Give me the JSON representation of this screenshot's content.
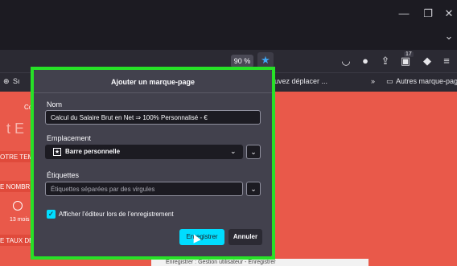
{
  "toolbar": {
    "zoom": "90 %",
    "bookmark_star_icon": "star-icon",
    "badge_count": "17"
  },
  "bookmarks_bar": {
    "left_fragment": "Sı",
    "move_hint": "uvez déplacer ...",
    "other_bookmarks": "Autres marque-pages"
  },
  "page_behind": {
    "frag_co": "Co",
    "frag_te": "t E",
    "frag_votre": "OTRE TEM",
    "frag_nombre": "E NOMBRE",
    "frag_mois": "13 mois",
    "frag_taux": "E TAUX DE"
  },
  "dialog": {
    "title": "Ajouter un marque-page",
    "name_label": "Nom",
    "name_value": "Calcul du Salaire Brut en Net ⇒ 100% Personnalisé - €",
    "location_label": "Emplacement",
    "location_value": "Barre personnelle",
    "tags_label": "Étiquettes",
    "tags_placeholder": "Étiquettes séparées par des virgules",
    "show_editor_label": "Afficher l’éditeur lors de l’enregistrement",
    "save_button": "Enregistrer",
    "cancel_button": "Annuler"
  },
  "taskbar_peek": {
    "text": "Enregistrer : Gestion utilisateur - Enregistrer"
  }
}
